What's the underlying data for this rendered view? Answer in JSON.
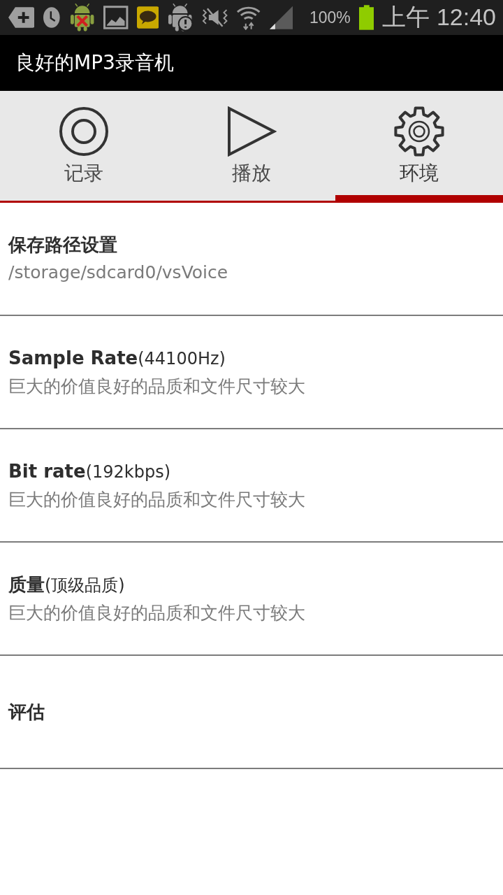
{
  "status_bar": {
    "battery": "100%",
    "time": "上午 12:40"
  },
  "app_bar": {
    "title": "良好的MP3录音机"
  },
  "tabs": [
    {
      "label": "记录",
      "selected": false
    },
    {
      "label": "播放",
      "selected": false
    },
    {
      "label": "环境",
      "selected": true
    }
  ],
  "settings": [
    {
      "title": "保存路径设置",
      "summary": "/storage/sdcard0/vsVoice"
    },
    {
      "title": "Sample Rate",
      "value": "(44100Hz)",
      "summary": "巨大的价值良好的品质和文件尺寸较大"
    },
    {
      "title": "Bit rate",
      "value": "(192kbps)",
      "summary": "巨大的价值良好的品质和文件尺寸较大"
    },
    {
      "title": "质量",
      "value": "(顶级品质)",
      "summary": "巨大的价值良好的品质和文件尺寸较大"
    },
    {
      "title": "评估"
    }
  ]
}
